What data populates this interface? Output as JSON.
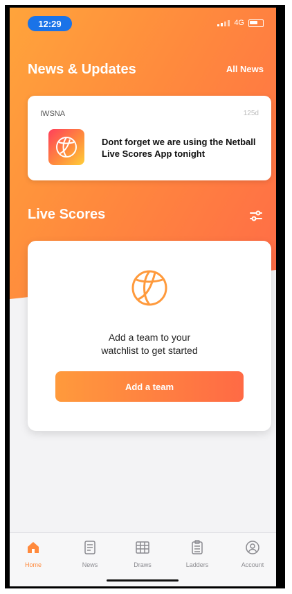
{
  "status_bar": {
    "time": "12:29",
    "network": "4G"
  },
  "news": {
    "title": "News & Updates",
    "all_news_label": "All News",
    "card": {
      "source": "IWSNA",
      "age": "125d",
      "text": "Dont forget we are using the Netball Live Scores App tonight"
    }
  },
  "live_scores": {
    "title": "Live Scores",
    "empty_text_line1": "Add a team to your",
    "empty_text_line2": "watchlist to get started",
    "add_button_label": "Add a team"
  },
  "tabbar": {
    "items": [
      {
        "label": "Home",
        "icon": "home-icon",
        "active": true
      },
      {
        "label": "News",
        "icon": "news-icon",
        "active": false
      },
      {
        "label": "Draws",
        "icon": "draws-icon",
        "active": false
      },
      {
        "label": "Ladders",
        "icon": "ladders-icon",
        "active": false
      },
      {
        "label": "Account",
        "icon": "account-icon",
        "active": false
      }
    ]
  },
  "colors": {
    "accent": "#ff8a3d",
    "gradient_start": "#ffa43b",
    "gradient_end": "#ff6b47",
    "time_pill": "#1a73e8"
  }
}
